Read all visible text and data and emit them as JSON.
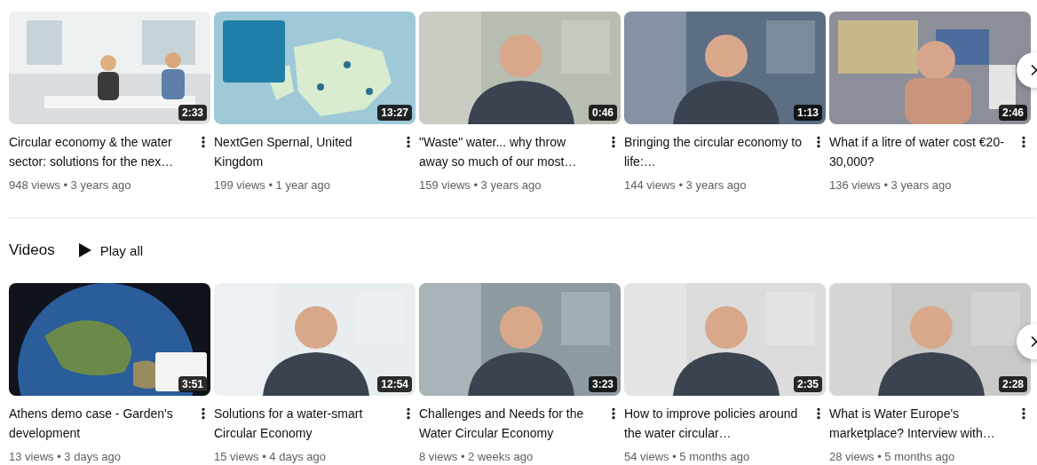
{
  "shelves": [
    {
      "videos": [
        {
          "title": "Circular economy & the water sector: solutions for the nex…",
          "meta": "948 views • 3 years ago",
          "duration": "2:33",
          "kind": "picture"
        },
        {
          "title": "NextGen Spernal, United Kingdom",
          "meta": "199 views • 1 year ago",
          "duration": "13:27",
          "kind": "picture"
        },
        {
          "title": "\"Waste\" water... why throw away so much of our most…",
          "meta": "159 views • 3 years ago",
          "duration": "0:46",
          "kind": "picture"
        },
        {
          "title": "Bringing the circular economy to life:…",
          "meta": "144 views • 3 years ago",
          "duration": "1:13",
          "kind": "picture"
        },
        {
          "title": "What if a litre of water cost €20-30,000?",
          "meta": "136 views • 3 years ago",
          "duration": "2:46",
          "kind": "picture"
        }
      ]
    },
    {
      "title": "Videos",
      "play_all": "Play all",
      "videos": [
        {
          "title": "Athens demo case - Garden's development",
          "meta": "13 views • 3 days ago",
          "duration": "3:51",
          "kind": "picture"
        },
        {
          "title": "Solutions for a water-smart Circular Economy",
          "meta": "15 views • 4 days ago",
          "duration": "12:54",
          "kind": "picture"
        },
        {
          "title": "Challenges and Needs for the Water Circular Economy",
          "meta": "8 views • 2 weeks ago",
          "duration": "3:23",
          "kind": "picture"
        },
        {
          "title": "How to improve policies around the water circular…",
          "meta": "54 views • 5 months ago",
          "duration": "2:35",
          "kind": "picture"
        },
        {
          "title": "What is Water Europe's marketplace? Interview with…",
          "meta": "28 views • 5 months ago",
          "duration": "2:28",
          "kind": "picture"
        }
      ]
    }
  ]
}
